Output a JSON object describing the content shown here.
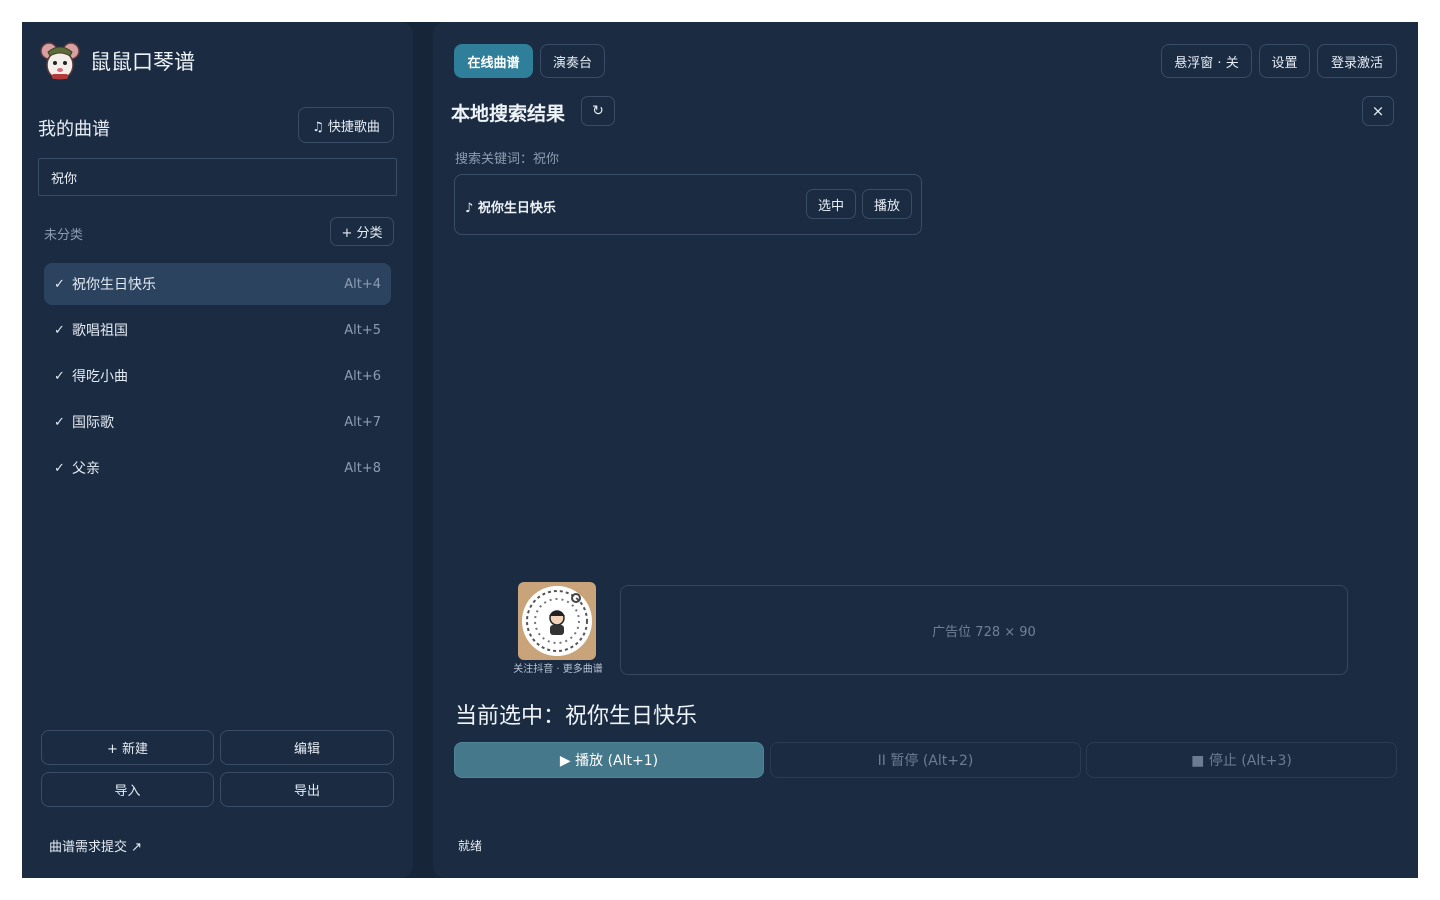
{
  "app": {
    "title": "鼠鼠口琴谱"
  },
  "sidebar": {
    "heading": "我的曲谱",
    "quick_song_label": "♫ 快捷歌曲",
    "search_value": "祝你",
    "category_label": "未分类",
    "add_category_label": "+ 分类",
    "songs": [
      {
        "check": "✓",
        "name": "祝你生日快乐",
        "hotkey": "Alt+4",
        "selected": true
      },
      {
        "check": "✓",
        "name": "歌唱祖国",
        "hotkey": "Alt+5",
        "selected": false
      },
      {
        "check": "✓",
        "name": "得吃小曲",
        "hotkey": "Alt+6",
        "selected": false
      },
      {
        "check": "✓",
        "name": "国际歌",
        "hotkey": "Alt+7",
        "selected": false
      },
      {
        "check": "✓",
        "name": "父亲",
        "hotkey": "Alt+8",
        "selected": false
      }
    ],
    "new_label": "+ 新建",
    "edit_label": "编辑",
    "import_label": "导入",
    "export_label": "导出",
    "request_link": "曲谱需求提交 ↗"
  },
  "header": {
    "tabs": [
      {
        "label": "在线曲谱",
        "active": true
      },
      {
        "label": "演奏台",
        "active": false
      }
    ],
    "float_window_label": "悬浮窗 · 关",
    "settings_label": "设置",
    "login_label": "登录激活"
  },
  "results": {
    "title": "本地搜索结果",
    "refresh_icon": "↻",
    "close_icon": "×",
    "keyword_text": "搜索关键词：祝你",
    "items": [
      {
        "name": "♪ 祝你生日快乐",
        "select_label": "选中",
        "play_label": "播放"
      }
    ]
  },
  "promo": {
    "qr_caption": "关注抖音 · 更多曲谱",
    "ad_text": "广告位 728 × 90"
  },
  "player": {
    "current_text": "当前选中：祝你生日快乐",
    "play_label": "▶ 播放 (Alt+1)",
    "pause_label": "II 暂停 (Alt+2)",
    "stop_label": "■ 停止 (Alt+3)"
  },
  "status": {
    "text": "就绪"
  },
  "colors": {
    "background": "#172538",
    "panel": "#1b2b42",
    "accent": "#2f7e9a",
    "play_button": "#45788a",
    "selected_row": "#2c4360"
  }
}
